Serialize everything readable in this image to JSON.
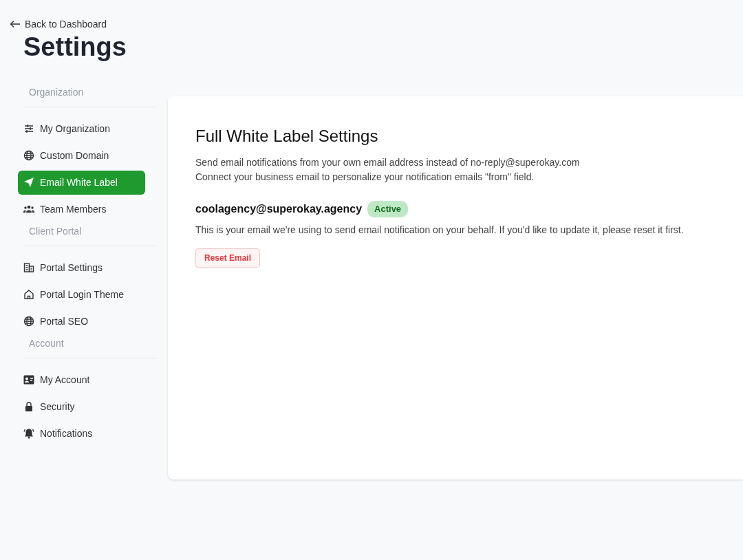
{
  "back_link": "Back to Dashboard",
  "page_title": "Settings",
  "sidebar": {
    "sections": [
      {
        "heading": "Organization",
        "items": [
          {
            "label": "My Organization",
            "selected": false
          },
          {
            "label": "Custom Domain",
            "selected": false
          },
          {
            "label": "Email White Label",
            "selected": true
          },
          {
            "label": "Team Members",
            "selected": false
          }
        ]
      },
      {
        "heading": "Client Portal",
        "items": [
          {
            "label": "Portal Settings",
            "selected": false
          },
          {
            "label": "Portal Login Theme",
            "selected": false
          },
          {
            "label": "Portal SEO",
            "selected": false
          }
        ]
      },
      {
        "heading": "Account",
        "items": [
          {
            "label": "My Account",
            "selected": false
          },
          {
            "label": "Security",
            "selected": false
          },
          {
            "label": "Notifications",
            "selected": false
          }
        ]
      }
    ]
  },
  "panel": {
    "title": "Full White Label Settings",
    "description": [
      "Send email notifications from your own email address instead of no-reply@superokay.com",
      "Connect your business email to personalize your notification emails \"from\" field."
    ],
    "email": "coolagency@superokay.agency",
    "status": "Active",
    "note": "This is your email we're using to send email notification on your behalf. If you'd like to update it, please reset it first.",
    "reset_button": "Reset Email"
  }
}
